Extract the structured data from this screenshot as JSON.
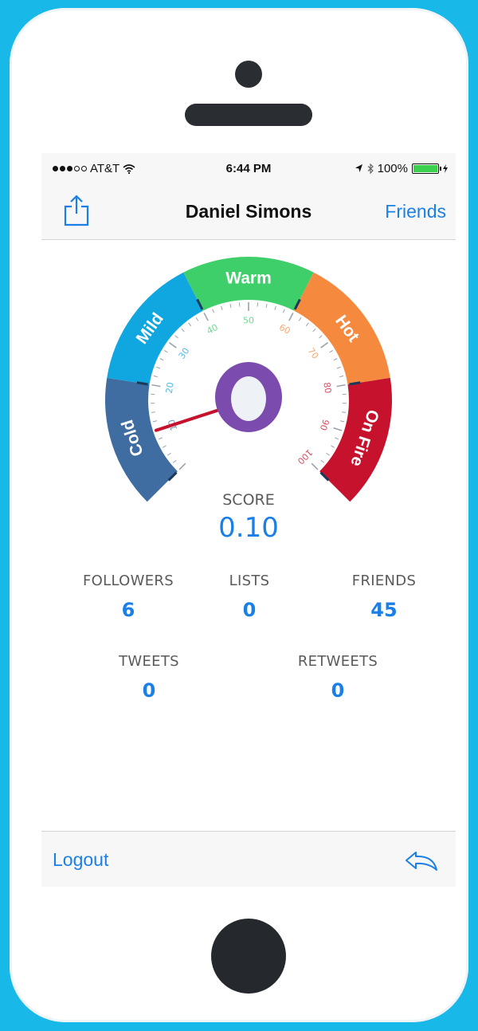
{
  "status_bar": {
    "carrier": "AT&T",
    "time": "6:44 PM",
    "battery": "100%",
    "battery_color": "#3bd14c"
  },
  "nav": {
    "title": "Daniel Simons",
    "friends_label": "Friends",
    "share_icon": "share-icon"
  },
  "gauge": {
    "zones": [
      {
        "label": "Cold",
        "color": "#3f6da2"
      },
      {
        "label": "Mild",
        "color": "#10a6df"
      },
      {
        "label": "Warm",
        "color": "#3fcf6a"
      },
      {
        "label": "Hot",
        "color": "#f58a3f"
      },
      {
        "label": "On Fire",
        "color": "#c6122c"
      }
    ],
    "ticks": [
      "10",
      "20",
      "30",
      "40",
      "50",
      "60",
      "70",
      "80",
      "90",
      "100"
    ],
    "score_label": "SCORE",
    "score_value": "0.10",
    "needle_value": 0.1,
    "center_ring_color": "#7b4cad"
  },
  "stats": {
    "followers": {
      "label": "FOLLOWERS",
      "value": "6"
    },
    "lists": {
      "label": "LISTS",
      "value": "0"
    },
    "friends": {
      "label": "FRIENDS",
      "value": "45"
    },
    "tweets": {
      "label": "TWEETS",
      "value": "0"
    },
    "retweets": {
      "label": "RETWEETS",
      "value": "0"
    }
  },
  "toolbar": {
    "logout_label": "Logout",
    "reply_icon": "reply-icon"
  },
  "colors": {
    "accent": "#1a7fe6",
    "device_background": "#18b8e8"
  }
}
